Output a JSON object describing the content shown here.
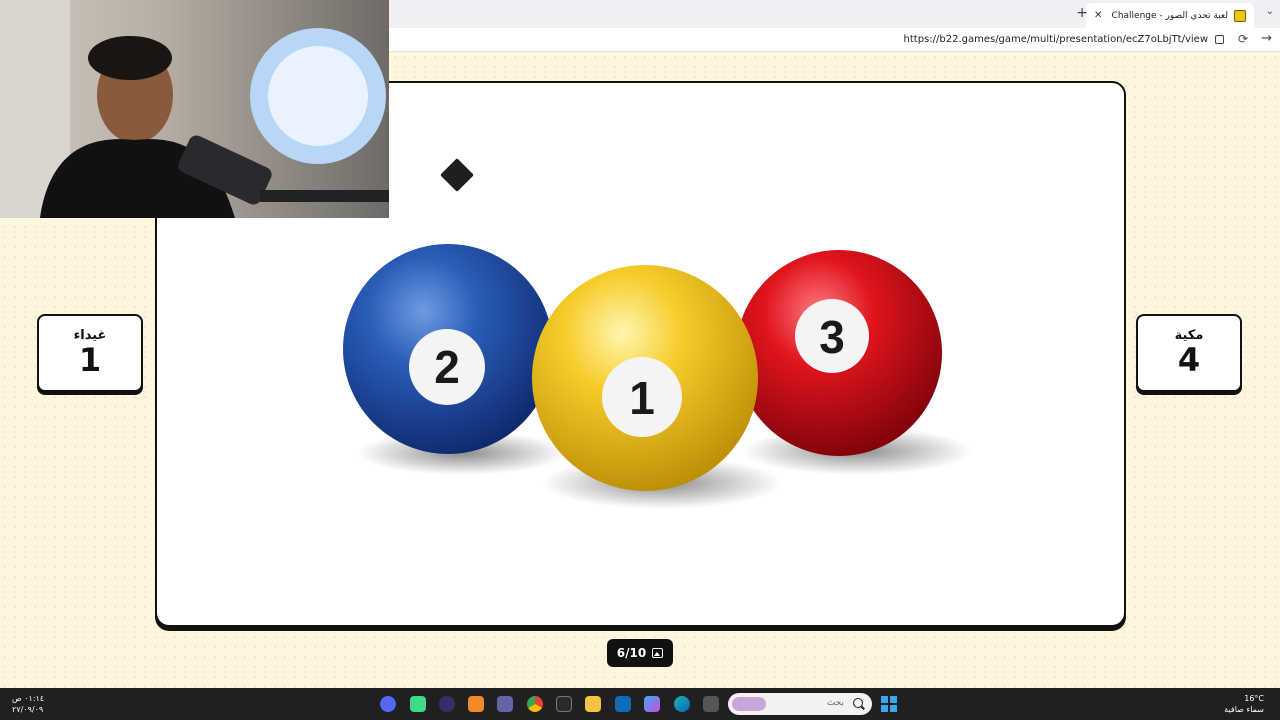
{
  "browser": {
    "tab_title": "لعبة تحدي الصور - Photo Challenge",
    "new_tab_symbol": "+",
    "close_symbol": "✕",
    "url": "https://b22.games/game/multi/presentation/ecZ7oLbjTt/view"
  },
  "game": {
    "left_player": {
      "name": "غيداء",
      "score": "1"
    },
    "right_player": {
      "name": "مكية",
      "score": "4"
    },
    "counter": "6/10",
    "balls": [
      {
        "number": "2",
        "color": "#1f4fa8"
      },
      {
        "number": "1",
        "color": "#f2c21a"
      },
      {
        "number": "3",
        "color": "#d8101c"
      }
    ]
  },
  "taskbar": {
    "time": "٠١:١٤ ص",
    "date": "٢٧/٠٩/٠٩",
    "search_placeholder": "بحث",
    "temperature": "16°C",
    "weather": "سماء صافية"
  },
  "colors": {
    "page_background": "#fdf5df",
    "card_border": "#111111"
  }
}
